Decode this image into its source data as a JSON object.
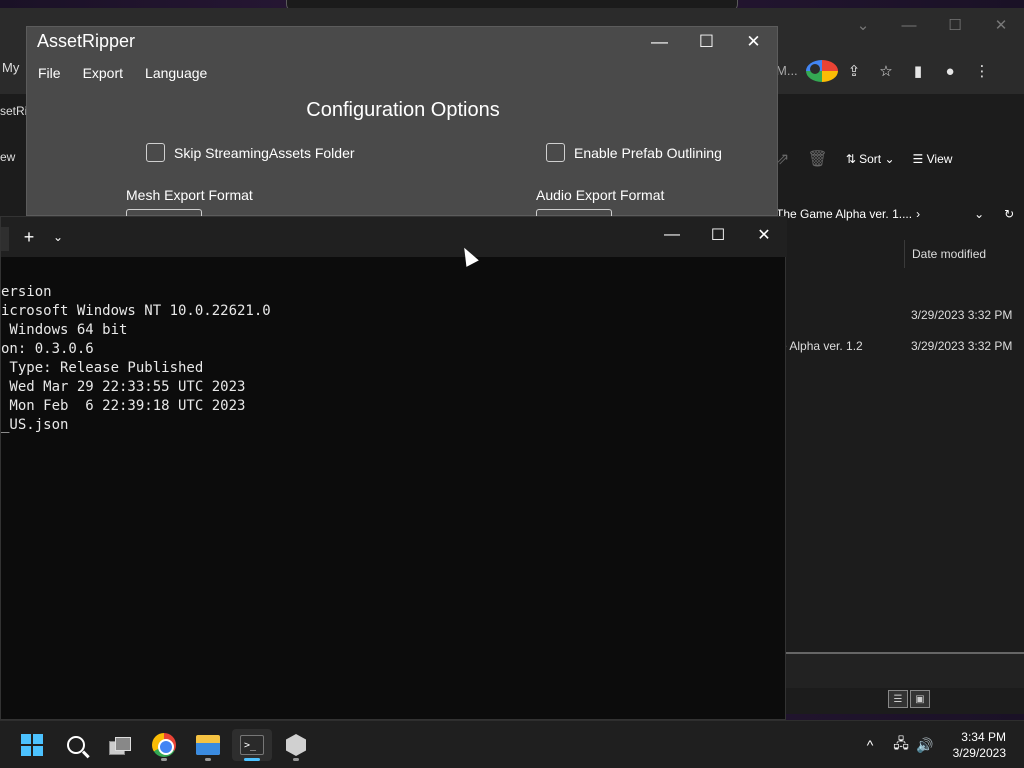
{
  "chrome": {
    "left_text": "My",
    "url_tail": "M..."
  },
  "explorer": {
    "left_tab": "setRi",
    "view_left": "ew",
    "sort_label": "Sort",
    "view_label": "View",
    "address": "The Game Alpha ver. 1....",
    "column_date": "Date modified",
    "rows": [
      {
        "name": "",
        "date": "3/29/2023 3:32 PM"
      },
      {
        "name": "e Alpha ver. 1.2",
        "date": "3/29/2023 3:32 PM"
      }
    ]
  },
  "assetripper": {
    "title": "AssetRipper",
    "menu": [
      "File",
      "Export",
      "Language"
    ],
    "heading": "Configuration Options",
    "checkbox_skip": "Skip StreamingAssets Folder",
    "checkbox_prefab": "Enable Prefab Outlining",
    "mesh_label": "Mesh Export Format",
    "audio_label": "Audio Export Format"
  },
  "terminal": {
    "lines": [
      "ersion",
      "icrosoft Windows NT 10.0.22621.0",
      " Windows 64 bit",
      "on: 0.3.0.6",
      " Type: Release Published",
      " Wed Mar 29 22:33:55 UTC 2023",
      " Mon Feb  6 22:39:18 UTC 2023",
      "_US.json"
    ]
  },
  "taskbar": {
    "time": "3:34 PM",
    "date": "3/29/2023"
  },
  "colors": {
    "accent": "#4cc2ff"
  }
}
